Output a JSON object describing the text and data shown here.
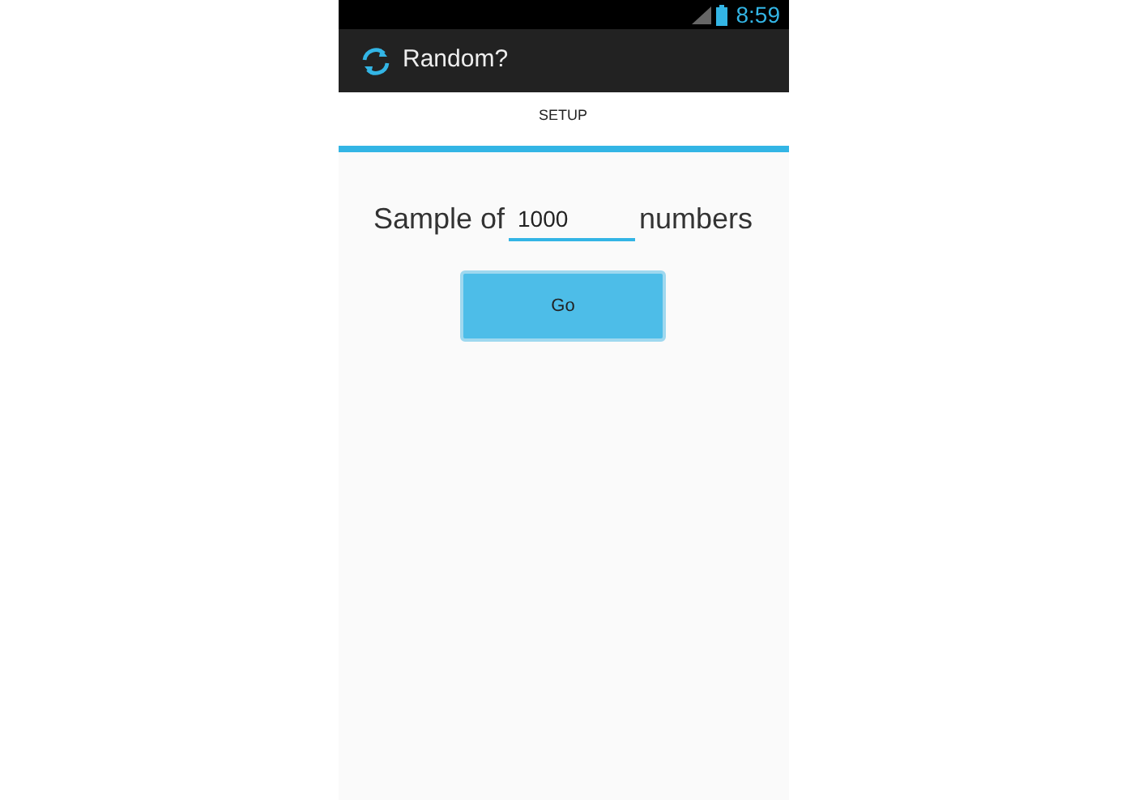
{
  "status_bar": {
    "time": "8:59"
  },
  "action_bar": {
    "title": "Random?"
  },
  "tabs": [
    {
      "label": "SETUP",
      "selected": true
    }
  ],
  "form": {
    "label_before": "Sample of",
    "value": "1000",
    "label_after": "numbers"
  },
  "buttons": [
    "Go"
  ]
}
